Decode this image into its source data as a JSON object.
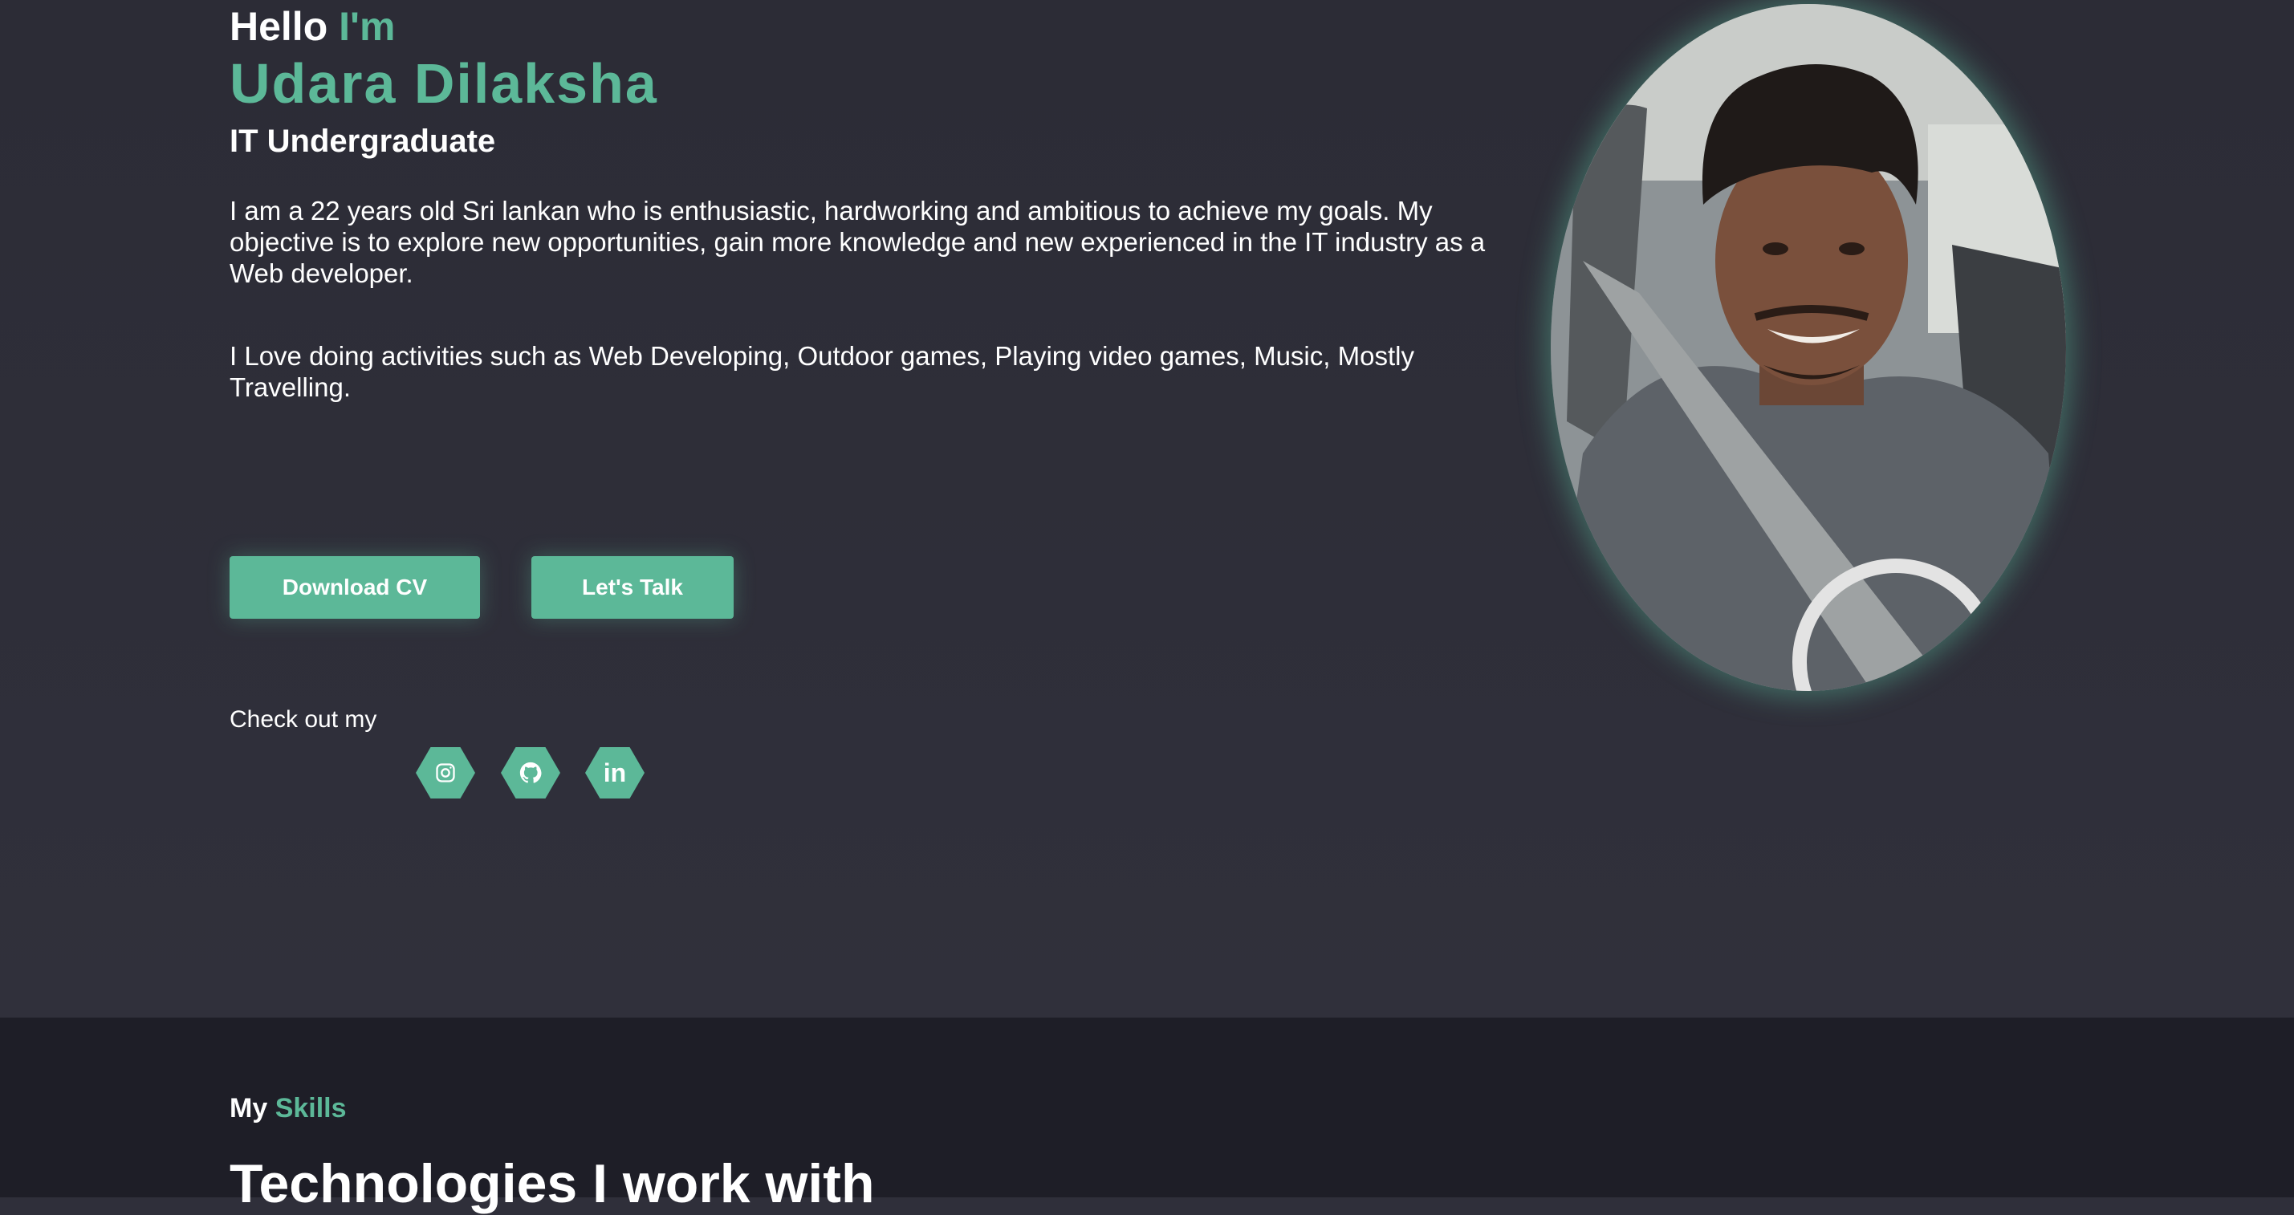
{
  "hero": {
    "hello": "Hello",
    "im": "I'm",
    "name": "Udara Dilaksha",
    "role": "IT Undergraduate",
    "para1": "I am a 22 years old Sri lankan who is enthusiastic, hardworking and ambitious to achieve my goals. My objective is to explore new opportunities, gain more knowledge and new experienced in the IT industry as a Web developer.",
    "para2": "I Love doing activities such as Web Developing, Outdoor games, Playing video games, Music, Mostly Travelling.",
    "buttons": {
      "download_cv": "Download CV",
      "lets_talk": "Let's Talk"
    },
    "check_out": "Check out my",
    "socials": [
      {
        "icon": "instagram-icon"
      },
      {
        "icon": "github-icon"
      },
      {
        "icon": "linkedin-icon",
        "text": "in"
      }
    ]
  },
  "skills": {
    "my": "My",
    "skills": "Skills",
    "heading": "Technologies I work with"
  },
  "colors": {
    "accent": "#5cb898",
    "hero_bg": "#2f2f3a",
    "skills_bg": "#1e1e27"
  }
}
